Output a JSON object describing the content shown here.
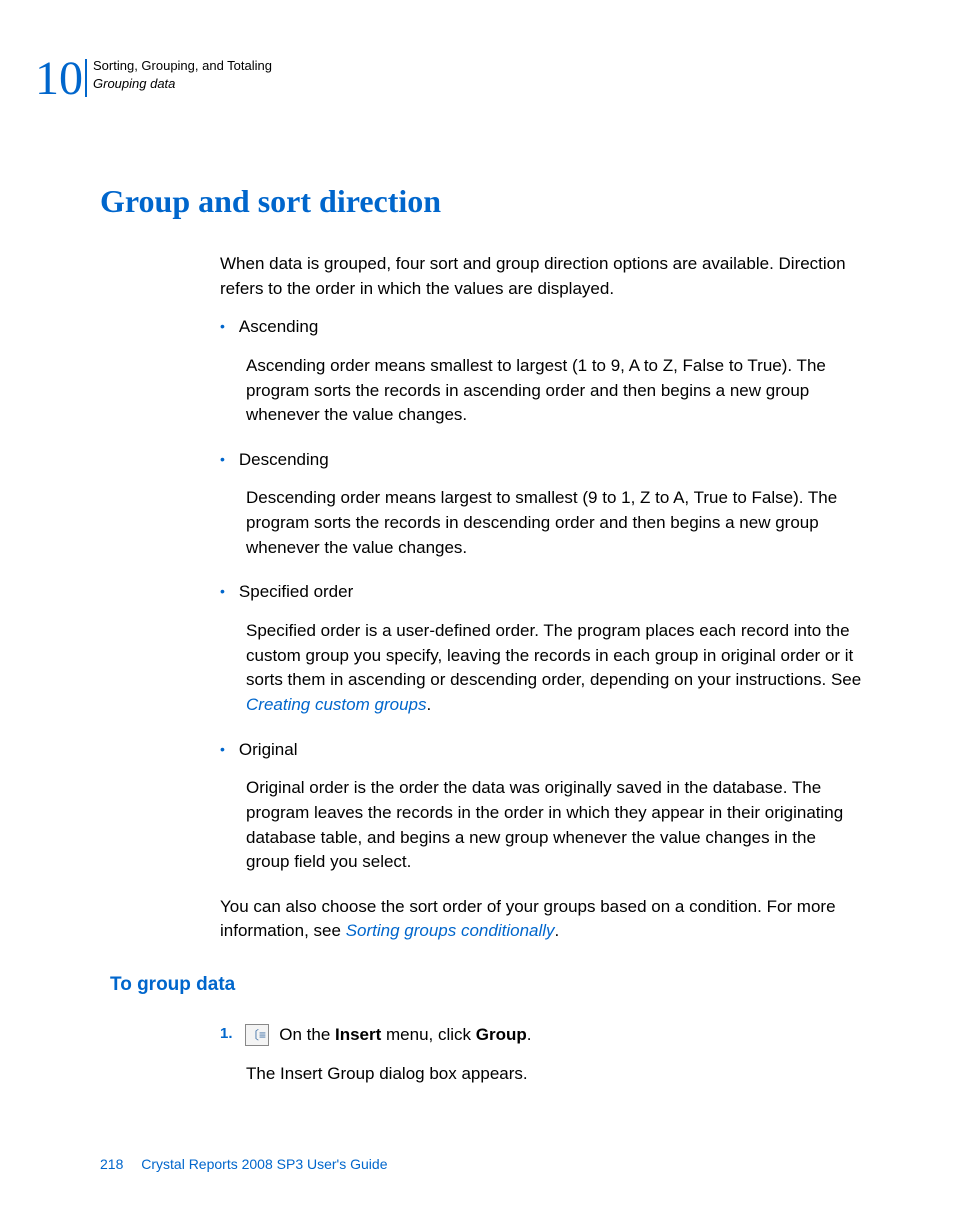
{
  "header": {
    "chapter_number": "10",
    "chapter_title": "Sorting, Grouping, and Totaling",
    "section_title": "Grouping data"
  },
  "h1": "Group and sort direction",
  "intro": "When data is grouped, four sort and group direction options are available. Direction refers to the order in which the values are displayed.",
  "bullets": [
    {
      "label": "Ascending",
      "desc": "Ascending order means smallest to largest (1 to 9, A to Z, False to True). The program sorts the records in ascending order and then begins a new group whenever the value changes."
    },
    {
      "label": "Descending",
      "desc": "Descending order means largest to smallest (9 to 1, Z to A, True to False). The program sorts the records in descending order and then begins a new group whenever the value changes."
    },
    {
      "label": "Specified order",
      "desc_pre": "Specified order is a user-defined order. The program places each record into the custom group you specify, leaving the records in each group in original order or it sorts them in ascending or descending order, depending on your instructions. See ",
      "link": "Creating custom groups",
      "desc_post": "."
    },
    {
      "label": "Original",
      "desc": "Original order is the order the data was originally saved in the database. The program leaves the records in the order in which they appear in their originating database table, and begins a new group whenever the value changes in the group field you select."
    }
  ],
  "outro_pre": "You can also choose the sort order of your groups based on a condition. For more information, see ",
  "outro_link": "Sorting groups conditionally",
  "outro_post": ".",
  "h2": "To group data",
  "step": {
    "num": "1.",
    "text_pre": " On the ",
    "bold1": "Insert",
    "text_mid": " menu, click ",
    "bold2": "Group",
    "text_post": ".",
    "sub": "The Insert Group dialog box appears."
  },
  "footer": {
    "page": "218",
    "doc": "Crystal Reports 2008 SP3 User's Guide"
  }
}
